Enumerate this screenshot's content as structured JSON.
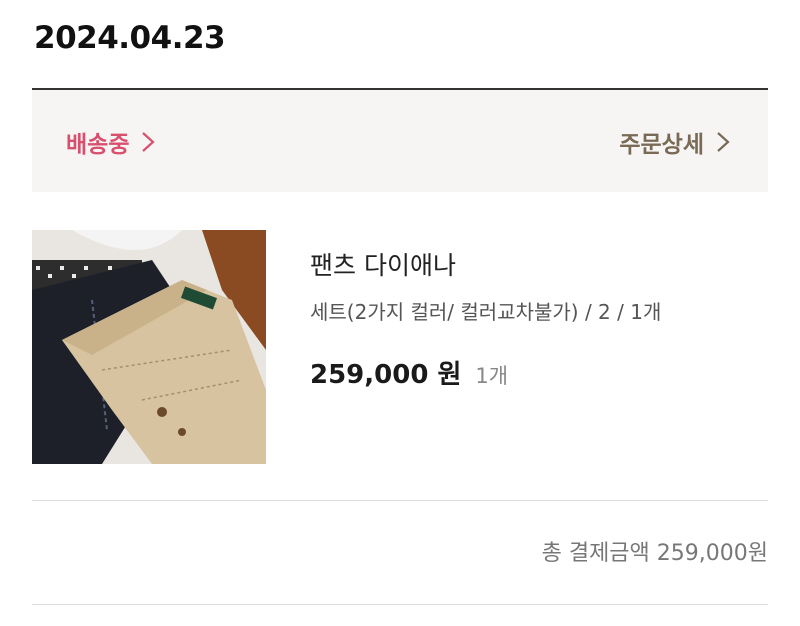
{
  "order": {
    "date": "2024.04.23",
    "status_label": "배송중",
    "detail_label": "주문상세"
  },
  "product": {
    "name": "팬츠 다이애나",
    "option": "세트(2가지 컬러/ 컬러교차불가) / 2 / 1개",
    "price": "259,000 원",
    "quantity": "1개",
    "image_icon": "pants-photo"
  },
  "summary": {
    "total": "총 결제금액 259,000원"
  },
  "colors": {
    "status": "#d9506e",
    "detail": "#7a6a55",
    "panel": "#f6f5f4"
  }
}
